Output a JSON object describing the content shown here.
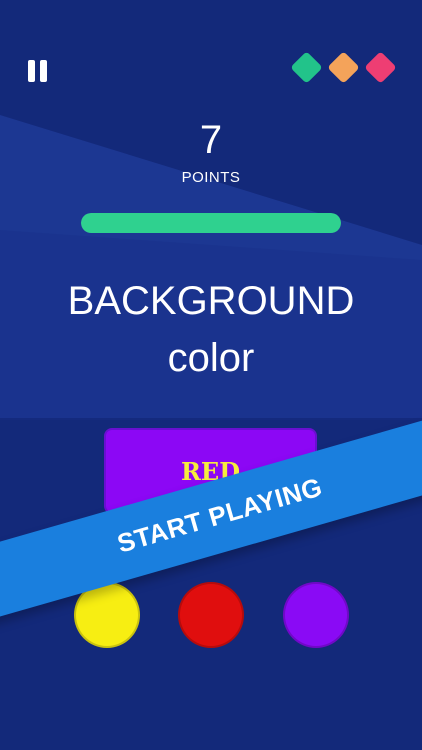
{
  "colors": {
    "background": "#13297a",
    "stripe": "#1e3a96",
    "gem1": "#22c38a",
    "gem2": "#f4a35a",
    "gem3": "#ee3e73",
    "timer": "#2fd18f",
    "card": "#8c07f5",
    "word": "#f7ec3d",
    "banner": "#1a7fde",
    "choice_yellow": "#f7ee12",
    "choice_red": "#e00e0e",
    "choice_purple": "#8a0af5"
  },
  "header": {
    "pause_icon": "pause-icon",
    "lives": [
      {
        "name": "life-gem-green",
        "color": "#22c38a"
      },
      {
        "name": "life-gem-orange",
        "color": "#f4a35a"
      },
      {
        "name": "life-gem-pink",
        "color": "#ee3e73"
      }
    ]
  },
  "score": {
    "value": "7",
    "label": "POINTS"
  },
  "timer": {
    "progress": 1.0
  },
  "prompt": {
    "line1": "BACKGROUND",
    "line2": "color"
  },
  "card": {
    "word": "RED"
  },
  "banner": {
    "label": "START PLAYING"
  },
  "choices": [
    {
      "name": "yellow",
      "color": "#f7ee12"
    },
    {
      "name": "red",
      "color": "#e00e0e"
    },
    {
      "name": "purple",
      "color": "#8a0af5"
    }
  ]
}
